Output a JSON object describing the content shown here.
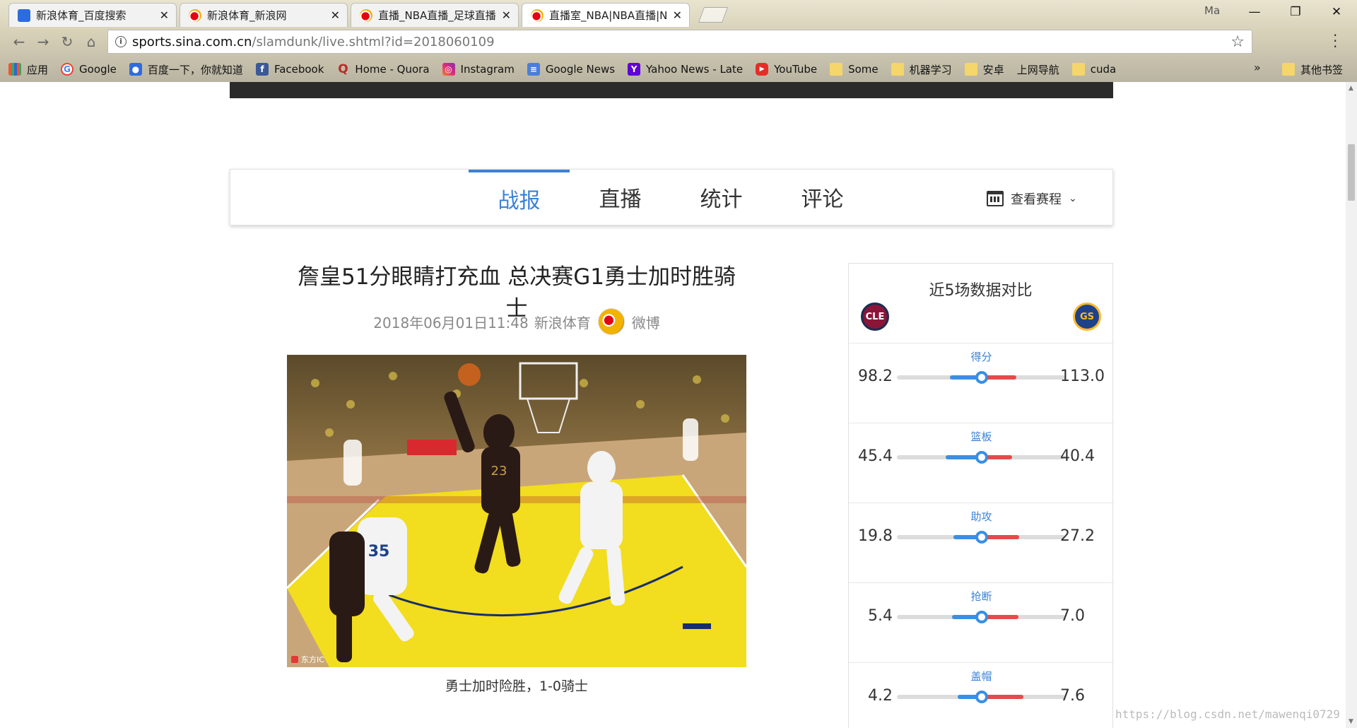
{
  "tabs": [
    {
      "title": "新浪体育_百度搜索",
      "icon": "baidu-paw-icon"
    },
    {
      "title": "新浪体育_新浪网",
      "icon": "sina-weibo-icon"
    },
    {
      "title": "直播_NBA直播_足球直播",
      "icon": "sina-weibo-icon"
    },
    {
      "title": "直播室_NBA|NBA直播|N",
      "icon": "sina-weibo-icon"
    }
  ],
  "window": {
    "user_label": "Ma",
    "minimize": "—",
    "restore": "❐",
    "close": "✕"
  },
  "address": {
    "host": "sports.sina.com.cn",
    "path": "/slamdunk/live.shtml?id=2018060109"
  },
  "bookmarks": [
    {
      "label": "应用",
      "icon": "apps-grid-icon"
    },
    {
      "label": "Google",
      "icon": "google-icon"
    },
    {
      "label": "百度一下，你就知道",
      "icon": "baidu-paw-icon"
    },
    {
      "label": "Facebook",
      "icon": "facebook-icon"
    },
    {
      "label": "Home - Quora",
      "icon": "quora-icon"
    },
    {
      "label": "Instagram",
      "icon": "instagram-icon"
    },
    {
      "label": "Google News",
      "icon": "google-news-icon"
    },
    {
      "label": "Yahoo News - Late",
      "icon": "yahoo-icon"
    },
    {
      "label": "YouTube",
      "icon": "youtube-icon"
    },
    {
      "label": "Some",
      "icon": "folder-icon"
    },
    {
      "label": "机器学习",
      "icon": "folder-icon"
    },
    {
      "label": "安卓",
      "icon": "folder-icon"
    },
    {
      "label": "上网导航",
      "icon": "page-icon"
    },
    {
      "label": "cuda",
      "icon": "folder-icon"
    }
  ],
  "bookmarks_more": "»",
  "bookmarks_other": "其他书签",
  "nav": {
    "tabs": [
      "战报",
      "直播",
      "统计",
      "评论"
    ],
    "active_index": 0,
    "schedule_label": "查看赛程"
  },
  "article": {
    "headline": "詹皇51分眼睛打充血 总决赛G1勇士加时胜骑士",
    "date": "2018年06月01日11:48",
    "source": "新浪体育",
    "weibo": "微博",
    "photo_credit": "东方IC",
    "caption": "勇士加时险胜，1-0骑士"
  },
  "stats": {
    "title": "近5场数据对比",
    "left_team": "CLE",
    "right_team": "GS",
    "rows": [
      {
        "label": "得分",
        "left": "98.2",
        "right": "113.0"
      },
      {
        "label": "篮板",
        "left": "45.4",
        "right": "40.4"
      },
      {
        "label": "助攻",
        "left": "19.8",
        "right": "27.2"
      },
      {
        "label": "抢断",
        "left": "5.4",
        "right": "7.0"
      },
      {
        "label": "盖帽",
        "left": "4.2",
        "right": "7.6"
      }
    ]
  },
  "watermark": "https://blog.csdn.net/mawenqi0729",
  "colors": {
    "accent": "#3b82d6",
    "left_bar": "#3b8fe3",
    "right_bar": "#e64a4a"
  }
}
